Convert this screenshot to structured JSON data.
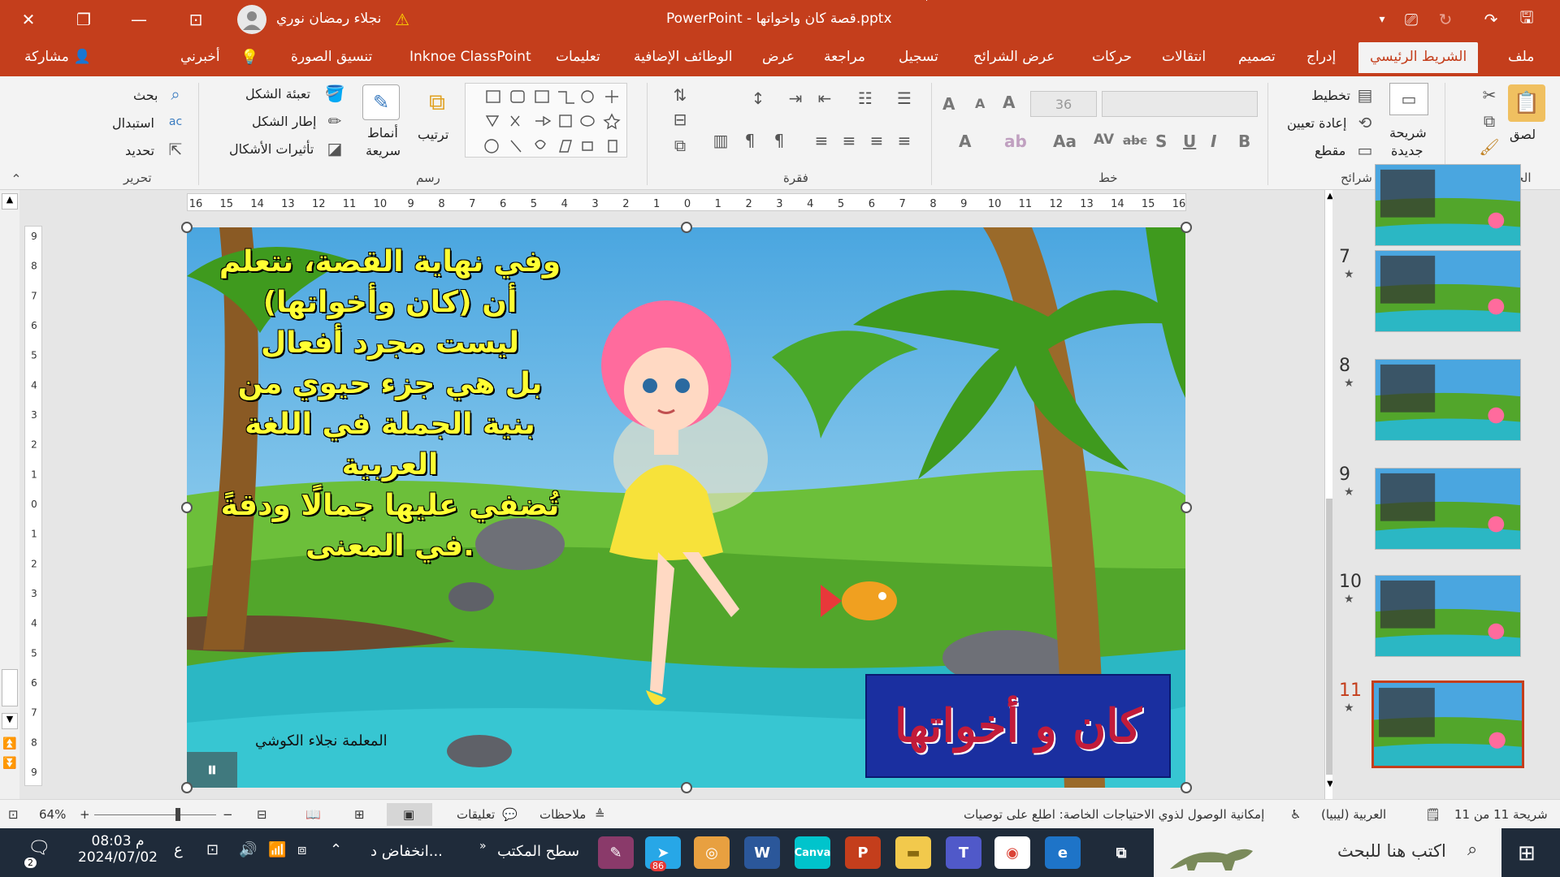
{
  "app": {
    "title": "PowerPoint  -  قصة كان واخواتها.pptx",
    "user_name": "نجلاء رمضان نوري",
    "accent_color": "#c43e1c"
  },
  "ribbon_tabs": [
    {
      "label": "ملف"
    },
    {
      "label": "الشريط الرئيسي",
      "active": true
    },
    {
      "label": "إدراج"
    },
    {
      "label": "تصميم"
    },
    {
      "label": "انتقالات"
    },
    {
      "label": "حركات"
    },
    {
      "label": "عرض الشرائح"
    },
    {
      "label": "تسجيل"
    },
    {
      "label": "مراجعة"
    },
    {
      "label": "عرض"
    },
    {
      "label": "الوظائف الإضافية"
    },
    {
      "label": "تعليمات"
    },
    {
      "label": "Inknoe ClassPoint"
    },
    {
      "label": "تنسيق الصورة"
    },
    {
      "label": "أخبرني"
    }
  ],
  "share_label": "مشاركة",
  "ribbon": {
    "clipboard": {
      "paste": "لصق",
      "group": "الحافظة"
    },
    "slides": {
      "new_slide_line1": "شريحة",
      "new_slide_line2": "جديدة",
      "layout": "تخطيط",
      "reset": "إعادة تعيين",
      "section": "مقطع",
      "group": "شرائح"
    },
    "font": {
      "size": "36",
      "group": "خط"
    },
    "paragraph": {
      "group": "فقرة"
    },
    "drawing": {
      "arrange": "ترتيب",
      "quick_styles_line1": "أنماط",
      "quick_styles_line2": "سريعة",
      "shape_fill": "تعبئة الشكل",
      "shape_outline": "إطار الشكل",
      "shape_effects": "تأثيرات الأشكال",
      "group": "رسم"
    },
    "editing": {
      "find": "بحث",
      "replace": "استبدال",
      "select": "تحديد",
      "group": "تحرير"
    }
  },
  "slide": {
    "text_lines": [
      "وفي نهاية القصة، نتعلم",
      "أن (كان وأخواتها)",
      "ليست مجرد أفعال",
      "بل هي جزء حيوي من",
      "بنية الجملة في اللغة",
      "العربية",
      "تُضفي عليها جمالًا ودقةً",
      "في المعنى."
    ],
    "title_box": "كان و أخواتها",
    "signature": "المعلمة نجلاء الكوشي",
    "text_color": "#ffff33",
    "title_bg": "#1a2fa0",
    "title_color": "#c21b3a"
  },
  "ruler": {
    "h_ticks": [
      "16",
      "15",
      "14",
      "13",
      "12",
      "11",
      "10",
      "9",
      "8",
      "7",
      "6",
      "5",
      "4",
      "3",
      "2",
      "1",
      "0",
      "1",
      "2",
      "3",
      "4",
      "5",
      "6",
      "7",
      "8",
      "9",
      "10",
      "11",
      "12",
      "13",
      "14",
      "15",
      "16"
    ],
    "v_ticks": [
      "9",
      "8",
      "7",
      "6",
      "5",
      "4",
      "3",
      "2",
      "1",
      "0",
      "1",
      "2",
      "3",
      "4",
      "5",
      "6",
      "7",
      "8",
      "9"
    ]
  },
  "thumbnails": [
    {
      "num": "",
      "star": ""
    },
    {
      "num": "7",
      "star": "★"
    },
    {
      "num": "8",
      "star": "★"
    },
    {
      "num": "9",
      "star": "★"
    },
    {
      "num": "10",
      "star": "★"
    },
    {
      "num": "11",
      "star": "★",
      "selected": true
    }
  ],
  "status": {
    "slide_count": "شريحة 11 من 11",
    "language": "العربية (ليبيا)",
    "accessibility": "إمكانية الوصول لذوي الاحتياجات الخاصة: اطلع على توصيات",
    "notes": "ملاحظات",
    "comments": "تعليقات",
    "zoom": "64%"
  },
  "taskbar": {
    "search_placeholder": "اكتب هنا للبحث",
    "time": "08:03 م",
    "date": "2024/07/02",
    "desktop": "سطح المكتب",
    "weather": "انخفاض د...",
    "notif_count": "2",
    "badge_86": "86",
    "lang": "ع"
  }
}
